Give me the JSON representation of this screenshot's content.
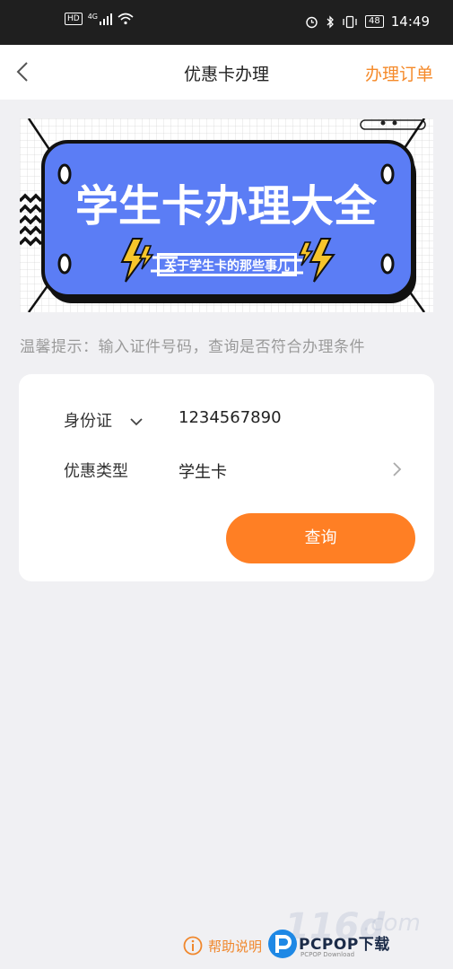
{
  "status_bar": {
    "hd": "HD",
    "network": "4G",
    "battery": "48",
    "time": "14:49"
  },
  "nav": {
    "title": "优惠卡办理",
    "right_action": "办理订单"
  },
  "banner": {
    "title": "学生卡办理大全",
    "subtitle": "关于学生卡的那些事儿",
    "bg_color": "#5b7df5",
    "accent_color": "#f7c52b"
  },
  "tip": "温馨提示：输入证件号码，查询是否符合办理条件",
  "form": {
    "id_type_label": "身份证",
    "id_number": "1234567890",
    "discount_label": "优惠类型",
    "discount_value": "学生卡",
    "submit_label": "查询"
  },
  "footer": {
    "help_label": "帮助说明"
  },
  "watermark": {
    "big": "116d",
    "com": ".com",
    "brand": "PCPOP下载",
    "sub": "PCPOP Download"
  },
  "colors": {
    "accent": "#ff7f24",
    "accent_text": "#f58a2a"
  }
}
